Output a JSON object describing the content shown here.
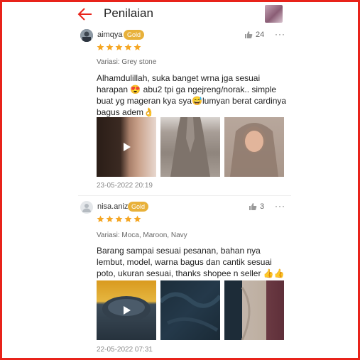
{
  "header": {
    "title": "Penilaian"
  },
  "reviews": [
    {
      "username": "aimqya",
      "badge": "Gold",
      "likes": "24",
      "rating": 5,
      "variation": "Variasi: Grey stone",
      "comment": "Alhamdulillah, suka banget wrna jga sesuai harapan 😍 abu2 tpi ga ngejreng/norak.. simple buat yg mageran kya sya😅lumyan berat cardinya bagus adem👌",
      "date": "23-05-2022 20:19"
    },
    {
      "username": "nisa.aniz",
      "badge": "Gold",
      "likes": "3",
      "rating": 5,
      "variation": "Variasi: Moca, Maroon, Navy",
      "comment": "Barang sampai sesuai pesanan, bahan nya lembut, model, warna bagus dan cantik sesuai poto, ukuran sesuai, thanks shopee n seller 👍👍",
      "date": "22-05-2022 07:31"
    }
  ],
  "colors": {
    "accent": "#e8231a",
    "star": "#f5a623",
    "badge": "#e8b13a"
  }
}
